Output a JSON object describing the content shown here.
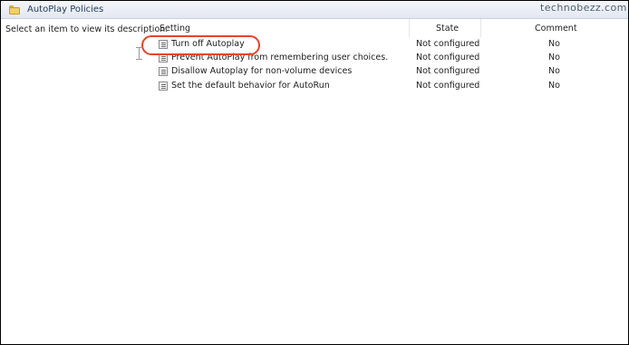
{
  "header": {
    "title": "AutoPlay Policies",
    "folder_icon": "folder-icon"
  },
  "watermark": "technobezz.com",
  "description_pane": {
    "text": "Select an item to view its description."
  },
  "columns": {
    "setting": "Setting",
    "state": "State",
    "comment": "Comment"
  },
  "policies": [
    {
      "setting": "Turn off Autoplay",
      "state": "Not configured",
      "comment": "No",
      "icon": "policy-setting-icon"
    },
    {
      "setting": "Prevent AutoPlay from remembering user choices.",
      "state": "Not configured",
      "comment": "No",
      "icon": "policy-setting-icon"
    },
    {
      "setting": "Disallow Autoplay for non-volume devices",
      "state": "Not configured",
      "comment": "No",
      "icon": "policy-setting-icon"
    },
    {
      "setting": "Set the default behavior for AutoRun",
      "state": "Not configured",
      "comment": "No",
      "icon": "policy-setting-icon"
    }
  ],
  "annotation": {
    "highlight_color": "#e2472b"
  }
}
